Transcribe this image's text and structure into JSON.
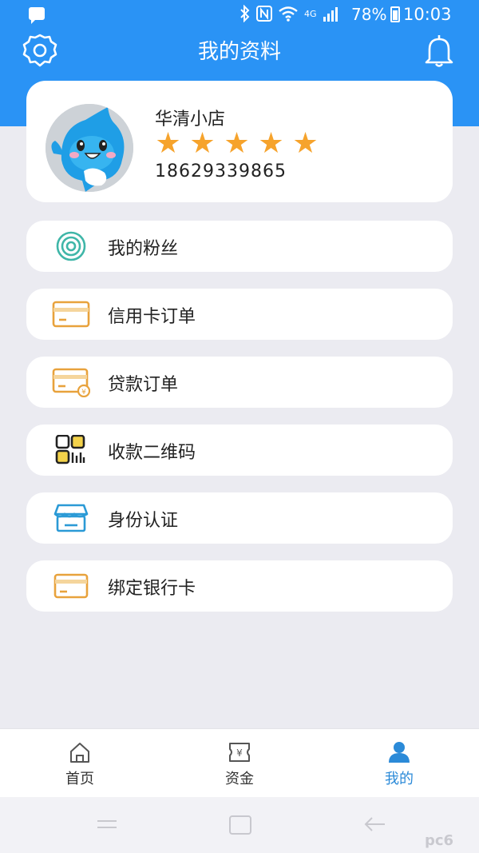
{
  "status_bar": {
    "battery_percent": "78%",
    "time": "10:03",
    "network_label": "4G"
  },
  "header": {
    "title": "我的资料",
    "settings_icon": "gear-icon",
    "notification_icon": "bell-icon"
  },
  "profile": {
    "shop_name": "华清小店",
    "rating": 5,
    "rating_max": 5,
    "phone": "18629339865",
    "star_color": "#f6a32c"
  },
  "menu": {
    "items": [
      {
        "label": "我的粉丝",
        "icon": "fans-icon"
      },
      {
        "label": "信用卡订单",
        "icon": "credit-card-icon"
      },
      {
        "label": "贷款订单",
        "icon": "loan-card-icon"
      },
      {
        "label": "收款二维码",
        "icon": "qr-code-icon"
      },
      {
        "label": "身份认证",
        "icon": "shop-verify-icon"
      },
      {
        "label": "绑定银行卡",
        "icon": "bank-card-icon"
      }
    ]
  },
  "tabs": [
    {
      "label": "首页",
      "icon": "home-icon",
      "active": false
    },
    {
      "label": "资金",
      "icon": "funds-icon",
      "active": false
    },
    {
      "label": "我的",
      "icon": "user-icon",
      "active": true
    }
  ],
  "colors": {
    "brand_blue": "#2a93f5",
    "active_tab": "#2b8ad8",
    "card_orange": "#e8a23c",
    "teal": "#3fb6a8"
  },
  "watermark": "pc6"
}
